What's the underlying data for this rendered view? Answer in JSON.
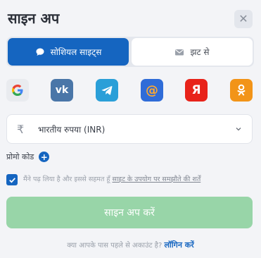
{
  "header": {
    "title": "साइन अप",
    "close_icon": "close-icon"
  },
  "tabs": [
    {
      "label": "सोशियल साइट्स",
      "icon": "chat-bubble-icon",
      "active": true
    },
    {
      "label": "झट से",
      "icon": "envelope-icon",
      "active": false
    }
  ],
  "socials": [
    {
      "name": "google",
      "glyph": "G"
    },
    {
      "name": "vk",
      "glyph": "vk"
    },
    {
      "name": "telegram",
      "glyph": "➤"
    },
    {
      "name": "mail",
      "glyph": "@"
    },
    {
      "name": "yandex",
      "glyph": "Я"
    },
    {
      "name": "odnoklassniki",
      "glyph": "ok"
    }
  ],
  "currency": {
    "symbol": "₹",
    "label": "भारतीय रुपया (INR)"
  },
  "promo": {
    "label": "प्रोमो कोड",
    "plus": "+"
  },
  "consent": {
    "checked": true,
    "text": "मैंने पढ़ लिया है और इससे सहमत हूँ",
    "link": "साइट के उपयोग पर समझौते की शर्तें"
  },
  "signup_button": {
    "label": "साइन अप करें"
  },
  "footer": {
    "question": "क्या आपके पास पहले से अकाउंट है?",
    "login": "लॉगिन करें"
  },
  "colors": {
    "primary": "#1565c0",
    "signup_disabled": "#98d5a8",
    "background": "#f3f4f7"
  }
}
